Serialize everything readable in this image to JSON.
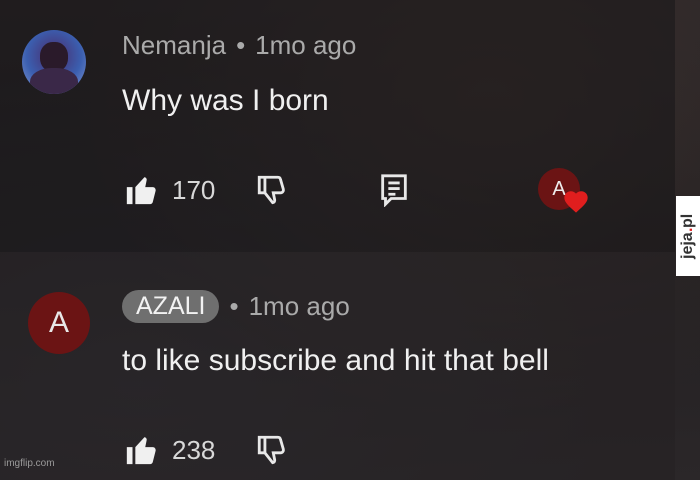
{
  "comments": [
    {
      "author": "Nemanja",
      "separator": "•",
      "time": "1mo ago",
      "text": "Why was I born",
      "likes": "170",
      "avatar_icon": "user-photo-avatar",
      "creator_heart_letter": "A"
    },
    {
      "author": "AZALI",
      "separator": "•",
      "time": "1mo ago",
      "text": "to like subscribe and hit that bell",
      "likes": "238",
      "avatar_letter": "A"
    }
  ],
  "watermarks": {
    "side_main": "jeja",
    "side_dot": ".",
    "side_tld": "pl",
    "bottom_left": "imgflip.com"
  },
  "colors": {
    "background": "#1e1c1e",
    "author_chip": "#6f6f6f",
    "avatar_red": "#6b1414",
    "heart": "#e01e1e"
  }
}
